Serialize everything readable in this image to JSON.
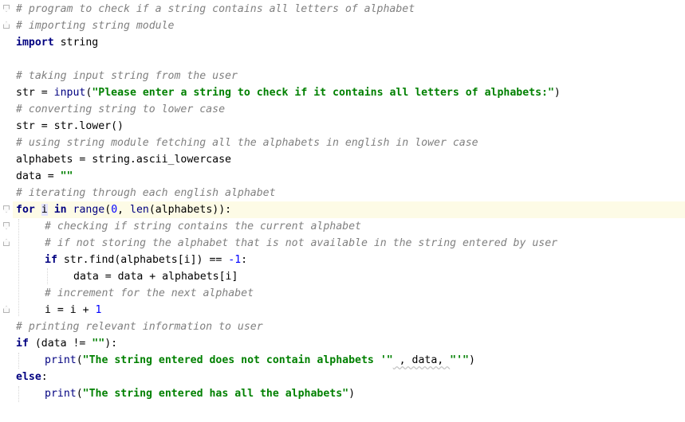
{
  "editor": {
    "lines": [
      {
        "indent": 0,
        "type": "comment",
        "text": "# program to check if a string contains all letters of alphabet"
      },
      {
        "indent": 0,
        "type": "comment",
        "text": "# importing string module"
      },
      {
        "indent": 0,
        "type": "code",
        "tokens": [
          {
            "t": "import",
            "c": "kw"
          },
          {
            "t": " string",
            "c": ""
          }
        ]
      },
      {
        "indent": 0,
        "type": "blank"
      },
      {
        "indent": 0,
        "type": "comment",
        "text": "# taking input string from the user"
      },
      {
        "indent": 0,
        "type": "code",
        "tokens": [
          {
            "t": "str",
            "c": ""
          },
          {
            "t": " = ",
            "c": ""
          },
          {
            "t": "input",
            "c": "bi"
          },
          {
            "t": "(",
            "c": ""
          },
          {
            "t": "\"Please enter a string to check if it contains all letters of alphabets:\"",
            "c": "st"
          },
          {
            "t": ")",
            "c": ""
          }
        ]
      },
      {
        "indent": 0,
        "type": "comment",
        "text": "# converting string to lower case"
      },
      {
        "indent": 0,
        "type": "code",
        "tokens": [
          {
            "t": "str = str.lower()",
            "c": ""
          }
        ]
      },
      {
        "indent": 0,
        "type": "comment",
        "text": "# using string module fetching all the alphabets in english in lower case"
      },
      {
        "indent": 0,
        "type": "code",
        "tokens": [
          {
            "t": "alphabets = string.ascii_lowercase",
            "c": ""
          }
        ]
      },
      {
        "indent": 0,
        "type": "code",
        "tokens": [
          {
            "t": "data = ",
            "c": ""
          },
          {
            "t": "\"\"",
            "c": "st"
          }
        ]
      },
      {
        "indent": 0,
        "type": "comment",
        "text": "# iterating through each english alphabet"
      },
      {
        "indent": 0,
        "type": "code",
        "current": true,
        "tokens": [
          {
            "t": "for",
            "c": "kw"
          },
          {
            "t": " ",
            "c": ""
          },
          {
            "t": "i",
            "c": "hl"
          },
          {
            "t": " ",
            "c": ""
          },
          {
            "t": "in",
            "c": "kw"
          },
          {
            "t": " ",
            "c": ""
          },
          {
            "t": "range",
            "c": "bi"
          },
          {
            "t": "(",
            "c": ""
          },
          {
            "t": "0",
            "c": "nu"
          },
          {
            "t": ", ",
            "c": ""
          },
          {
            "t": "len",
            "c": "bi"
          },
          {
            "t": "(alphabets)):",
            "c": ""
          }
        ]
      },
      {
        "indent": 1,
        "type": "comment",
        "text": "# checking if string contains the current alphabet"
      },
      {
        "indent": 1,
        "type": "comment",
        "text": "# if not storing the alphabet that is not available in the string entered by user"
      },
      {
        "indent": 1,
        "type": "code",
        "tokens": [
          {
            "t": "if",
            "c": "kw"
          },
          {
            "t": " str.find(alphabets[i]) == ",
            "c": ""
          },
          {
            "t": "-1",
            "c": "nu"
          },
          {
            "t": ":",
            "c": ""
          }
        ]
      },
      {
        "indent": 2,
        "type": "code",
        "tokens": [
          {
            "t": "data = data + alphabets[i]",
            "c": ""
          }
        ]
      },
      {
        "indent": 1,
        "type": "comment",
        "text": "# increment for the next alphabet"
      },
      {
        "indent": 1,
        "type": "code",
        "tokens": [
          {
            "t": "i = i + ",
            "c": ""
          },
          {
            "t": "1",
            "c": "nu"
          }
        ]
      },
      {
        "indent": 0,
        "type": "comment",
        "text": "# printing relevant information to user"
      },
      {
        "indent": 0,
        "type": "code",
        "tokens": [
          {
            "t": "if",
            "c": "kw"
          },
          {
            "t": " (data != ",
            "c": ""
          },
          {
            "t": "\"\"",
            "c": "st"
          },
          {
            "t": "):",
            "c": ""
          }
        ]
      },
      {
        "indent": 1,
        "type": "code",
        "tokens": [
          {
            "t": "print",
            "c": "bi"
          },
          {
            "t": "(",
            "c": ""
          },
          {
            "t": "\"The string entered does not contain alphabets '\"",
            "c": "st"
          },
          {
            "t": " , data, ",
            "c": "sq"
          },
          {
            "t": "\"'\"",
            "c": "st"
          },
          {
            "t": ")",
            "c": ""
          }
        ]
      },
      {
        "indent": 0,
        "type": "code",
        "tokens": [
          {
            "t": "else",
            "c": "kw"
          },
          {
            "t": ":",
            "c": ""
          }
        ]
      },
      {
        "indent": 1,
        "type": "code",
        "tokens": [
          {
            "t": "print",
            "c": "bi"
          },
          {
            "t": "(",
            "c": ""
          },
          {
            "t": "\"The string entered has all the alphabets\"",
            "c": "st"
          },
          {
            "t": ")",
            "c": ""
          }
        ]
      }
    ]
  },
  "colors": {
    "comment": "#808080",
    "keyword": "#000080",
    "string": "#008000",
    "number": "#0000ff",
    "current_line": "#fdfbe6"
  }
}
